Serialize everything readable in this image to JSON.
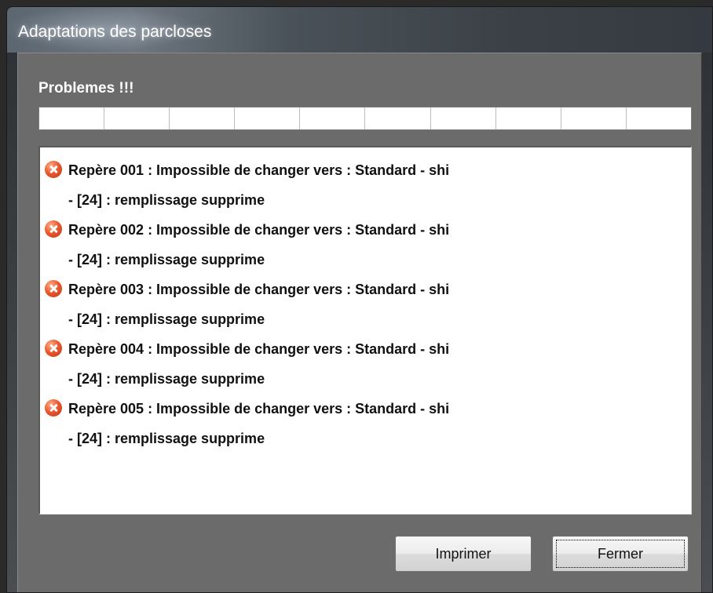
{
  "window": {
    "title": "Adaptations des parcloses"
  },
  "panel": {
    "section_label": "Problemes !!!"
  },
  "progress": {
    "segments": 10,
    "value": 0
  },
  "messages": [
    {
      "icon": "error-icon",
      "line1": "Repère 001 : Impossible de changer vers :  Standard - shi",
      "line2": "- [24] : remplissage supprime"
    },
    {
      "icon": "error-icon",
      "line1": "Repère 002 : Impossible de changer vers :  Standard - shi",
      "line2": "- [24] : remplissage supprime"
    },
    {
      "icon": "error-icon",
      "line1": "Repère 003 : Impossible de changer vers :  Standard - shi",
      "line2": "- [24] : remplissage supprime"
    },
    {
      "icon": "error-icon",
      "line1": "Repère 004 : Impossible de changer vers :  Standard - shi",
      "line2": "- [24] : remplissage supprime"
    },
    {
      "icon": "error-icon",
      "line1": "Repère 005 : Impossible de changer vers :  Standard - shi",
      "line2": "- [24] : remplissage supprime"
    }
  ],
  "buttons": {
    "print_label": "Imprimer",
    "close_label": "Fermer"
  },
  "colors": {
    "error": "#e0522a",
    "dialog_bg": "#6b6b6b",
    "list_bg": "#ffffff"
  }
}
